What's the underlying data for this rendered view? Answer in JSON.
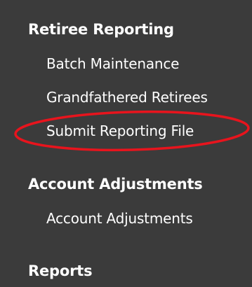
{
  "sidebar": {
    "sections": [
      {
        "heading": "Retiree Reporting",
        "items": [
          {
            "label": "Batch Maintenance"
          },
          {
            "label": "Grandfathered Retirees"
          },
          {
            "label": "Submit Reporting File"
          }
        ]
      },
      {
        "heading": "Account Adjustments",
        "items": [
          {
            "label": "Account Adjustments"
          }
        ]
      },
      {
        "heading": "Reports",
        "items": []
      }
    ]
  },
  "annotation": {
    "highlight_color": "#e8141d",
    "highlighted_item": "Submit Reporting File"
  },
  "colors": {
    "panel_background": "#3b3b3b",
    "text": "#ffffff"
  }
}
